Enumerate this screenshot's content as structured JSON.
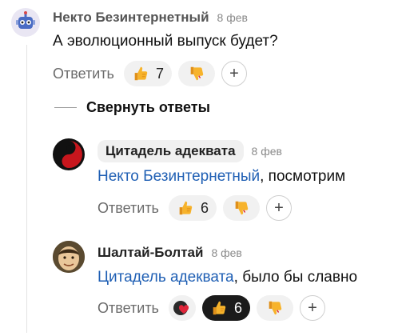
{
  "comments": [
    {
      "author": "Некто Безинтернетный",
      "date": "8 фев",
      "text": "А эволюционный выпуск будет?",
      "reply_label": "Ответить",
      "like_count": "7",
      "plus_label": "+"
    },
    {
      "author": "Цитадель адеквата",
      "date": "8 фев",
      "mention": "Некто Безинтернетный",
      "text_rest": ", посмотрим",
      "reply_label": "Ответить",
      "like_count": "6",
      "plus_label": "+"
    },
    {
      "author": "Шалтай-Болтай",
      "date": "8 фев",
      "mention": "Цитадель адеквата",
      "text_rest": ", было бы славно",
      "reply_label": "Ответить",
      "like_count": "6",
      "plus_label": "+"
    }
  ],
  "collapse_label": "Свернуть ответы",
  "icons": {
    "like": "thumbs-up-icon",
    "dislike": "thumbs-down-icon",
    "heart": "heart-icon",
    "add": "plus-icon"
  },
  "colors": {
    "mention": "#1f5fb4",
    "thumb": "#f5a623",
    "dark_pill": "#1b1b1b"
  }
}
